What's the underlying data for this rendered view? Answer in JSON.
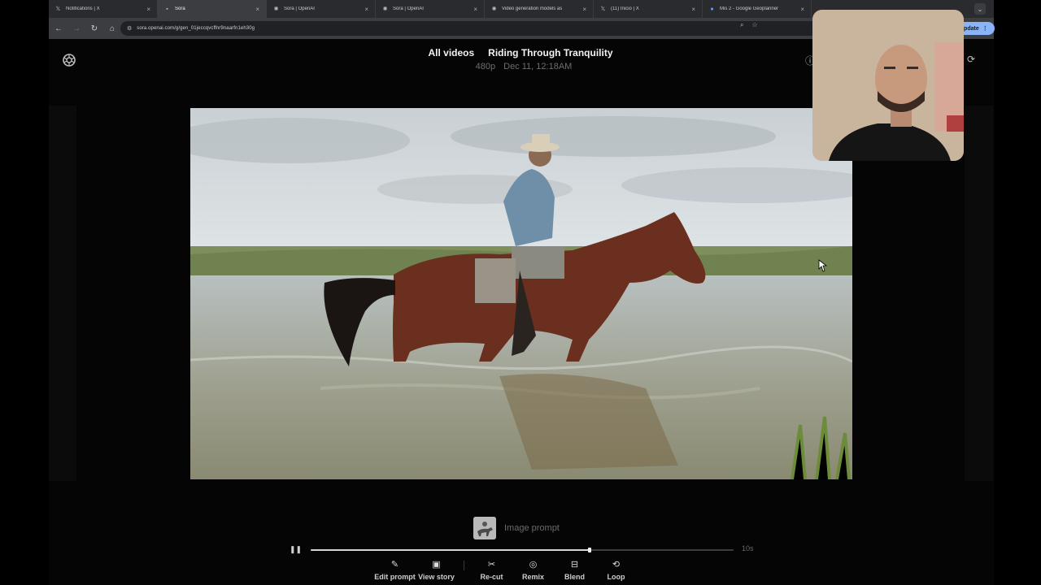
{
  "browser": {
    "tabs": [
      {
        "title": "Notifications | X",
        "icon": "x-logo-icon",
        "active": false
      },
      {
        "title": "Sora",
        "icon": "sora-logo-icon",
        "active": true
      },
      {
        "title": "Sora | OpenAI",
        "icon": "openai-logo-icon",
        "active": false
      },
      {
        "title": "Sora | OpenAI",
        "icon": "openai-logo-icon",
        "active": false
      },
      {
        "title": "Video generation models as",
        "icon": "openai-logo-icon",
        "active": false
      },
      {
        "title": "(11) Inicio | X",
        "icon": "x-logo-icon",
        "active": false
      },
      {
        "title": "Mis 2 - Google Geoplanner",
        "icon": "google-icon",
        "active": false
      }
    ],
    "url": "sora.openai.com/g/gen_01jeccqvcffnr9naarfn1eh30g",
    "update_label": "Update"
  },
  "header": {
    "all_videos": "All videos",
    "title": "Riding Through Tranquility",
    "resolution": "480p",
    "date": "Dec 11, 12:18AM"
  },
  "image_prompt": {
    "label": "Image prompt"
  },
  "player": {
    "progress": 0.66,
    "duration": "10s"
  },
  "actions": [
    {
      "label": "Edit prompt",
      "icon": "pencil-icon"
    },
    {
      "label": "View story",
      "icon": "storyboard-icon"
    },
    {
      "label": "Re-cut",
      "icon": "scissors-icon"
    },
    {
      "label": "Remix",
      "icon": "remix-icon"
    },
    {
      "label": "Blend",
      "icon": "blend-icon"
    },
    {
      "label": "Loop",
      "icon": "loop-icon"
    }
  ]
}
